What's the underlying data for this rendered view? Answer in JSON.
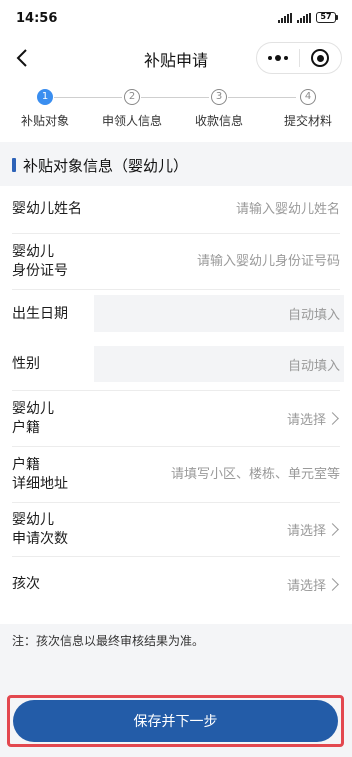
{
  "status_bar": {
    "time": "14:56",
    "battery": "57"
  },
  "nav": {
    "title": "补贴申请"
  },
  "steps": [
    {
      "num": "1",
      "label": "补贴对象",
      "active": true
    },
    {
      "num": "2",
      "label": "申领人信息",
      "active": false
    },
    {
      "num": "3",
      "label": "收款信息",
      "active": false
    },
    {
      "num": "4",
      "label": "提交材料",
      "active": false
    }
  ],
  "section": {
    "title": "补贴对象信息（婴幼儿）"
  },
  "form": {
    "name": {
      "label": "婴幼儿姓名",
      "placeholder": "请输入婴幼儿姓名"
    },
    "id": {
      "label_line1": "婴幼儿",
      "label_line2": "身份证号",
      "placeholder": "请输入婴幼儿身份证号码"
    },
    "birth": {
      "label": "出生日期",
      "value": "自动填入"
    },
    "gender": {
      "label": "性别",
      "value": "自动填入"
    },
    "household": {
      "label_line1": "婴幼儿",
      "label_line2": "户籍",
      "value": "请选择"
    },
    "address": {
      "label_line1": "户籍",
      "label_line2": "详细地址",
      "placeholder": "请填写小区、楼栋、单元室等"
    },
    "times": {
      "label_line1": "婴幼儿",
      "label_line2": "申请次数",
      "value": "请选择"
    },
    "order": {
      "label": "孩次",
      "value": "请选择"
    }
  },
  "note": "注：孩次信息以最终审核结果为准。",
  "submit": {
    "label": "保存并下一步"
  },
  "colors": {
    "primary": "#235ca8",
    "step_active": "#3a8ef0",
    "highlight": "#e3484f"
  },
  "icons": [
    "back-arrow-icon",
    "more-dots-icon",
    "close-target-icon",
    "chevron-right-icon"
  ]
}
